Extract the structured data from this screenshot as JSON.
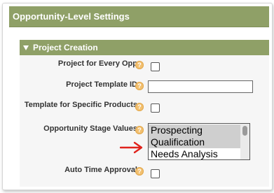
{
  "top_header": {
    "title": "Opportunity-Level Settings"
  },
  "section": {
    "title": "Project Creation",
    "fields": {
      "project_for_every_opp": {
        "label": "Project for Every Opp",
        "checked": false
      },
      "project_template_id": {
        "label": "Project Template ID",
        "value": ""
      },
      "template_for_specific_products": {
        "label": "Template for Specific Products",
        "checked": false
      },
      "opportunity_stage_values": {
        "label": "Opportunity Stage Values",
        "options": [
          {
            "text": "Prospecting",
            "selected": true
          },
          {
            "text": "Qualification",
            "selected": true
          },
          {
            "text": "Needs Analysis",
            "selected": false
          }
        ]
      },
      "auto_time_approval": {
        "label": "Auto Time Approval",
        "checked": false
      }
    }
  },
  "help_icon_glyph": "?",
  "colors": {
    "header_green": "#8fa067",
    "section_bg": "#f6f6f6",
    "help_orange": "#f2c070",
    "selection_gray": "#cfcfcf",
    "annotation_red": "#e0231c"
  }
}
